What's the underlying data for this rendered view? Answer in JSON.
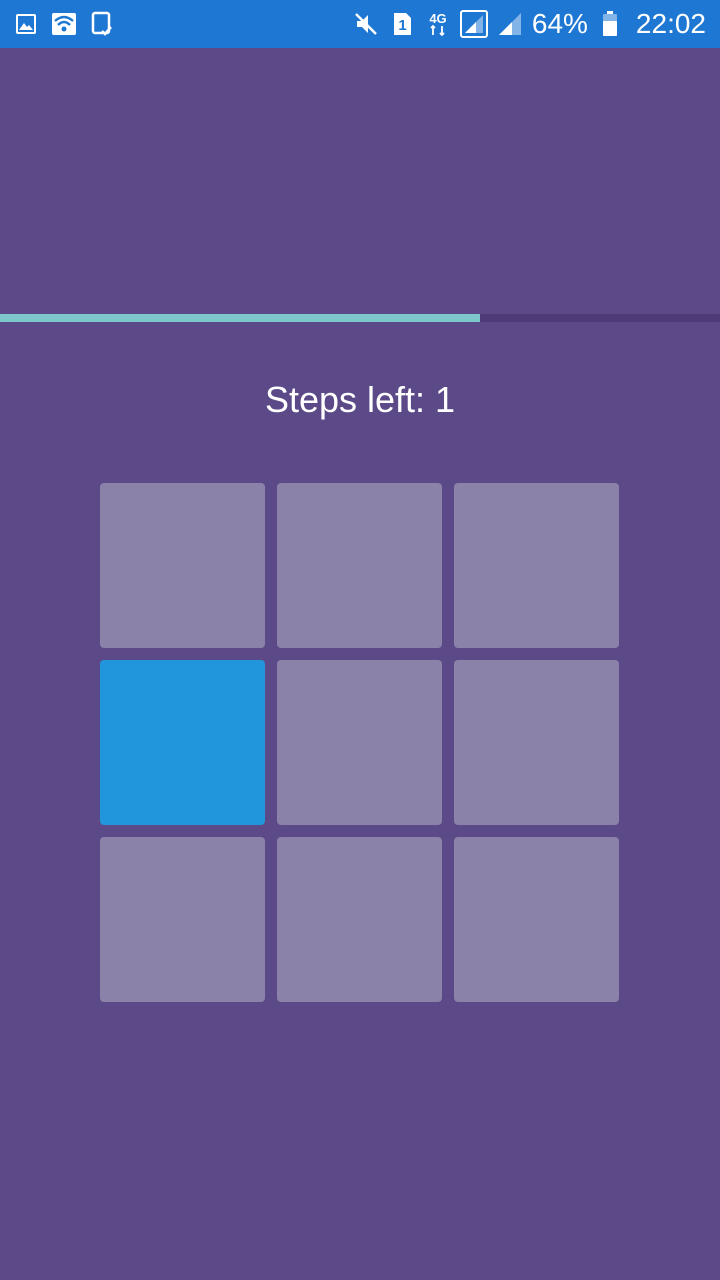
{
  "status_bar": {
    "icons_left": [
      "gallery-icon",
      "wifi-icon",
      "tablet-check-icon"
    ],
    "icons_right": [
      "mute-icon",
      "sim-1-icon",
      "network-4g-icon",
      "signal-icon",
      "signal-2-icon",
      "battery-icon"
    ],
    "battery": "64%",
    "time": "22:02",
    "sim_label": "1",
    "network_label": "4G"
  },
  "game": {
    "progress": 0.667,
    "steps_label": "Steps left: 1",
    "grid": {
      "rows": 3,
      "cols": 3,
      "active_cells": [
        [
          1,
          0
        ]
      ]
    },
    "colors": {
      "background": "#5c4987",
      "tile": "#8b82a9",
      "active_tile": "#2296dc",
      "progress_fill": "#7ec8cc",
      "progress_track": "#4d3b78"
    }
  }
}
